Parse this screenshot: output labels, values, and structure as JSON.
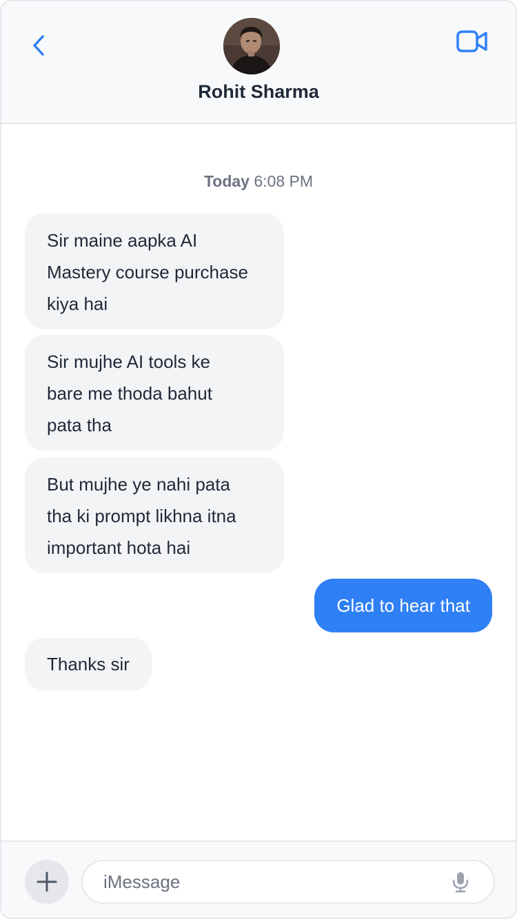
{
  "colors": {
    "accent": "#2f80f5",
    "incoming_bubble": "#f3f4f6",
    "header_bg": "#f8f9fb",
    "text_dark": "#1f2937",
    "text_muted": "#6b7280"
  },
  "header": {
    "back_icon": "chevron-left-icon",
    "video_icon": "video-camera-icon",
    "contact_name": "Rohit Sharma"
  },
  "thread": {
    "timestamp_day": "Today",
    "timestamp_time": "6:08 PM",
    "messages": [
      {
        "direction": "incoming",
        "lines": [
          "Sir maine aapka AI",
          "Mastery course purchase",
          "kiya hai"
        ]
      },
      {
        "direction": "incoming",
        "lines": [
          "Sir mujhe AI tools ke",
          "bare me thoda bahut",
          "pata tha"
        ]
      },
      {
        "direction": "incoming",
        "lines": [
          "But mujhe ye nahi pata",
          "tha ki prompt likhna itna",
          "important hota hai"
        ]
      },
      {
        "direction": "outgoing",
        "lines": [
          "Glad to hear that"
        ]
      },
      {
        "direction": "incoming",
        "lines": [
          "Thanks sir"
        ]
      }
    ]
  },
  "composer": {
    "plus_icon": "plus-icon",
    "placeholder": "iMessage",
    "mic_icon": "microphone-icon"
  }
}
